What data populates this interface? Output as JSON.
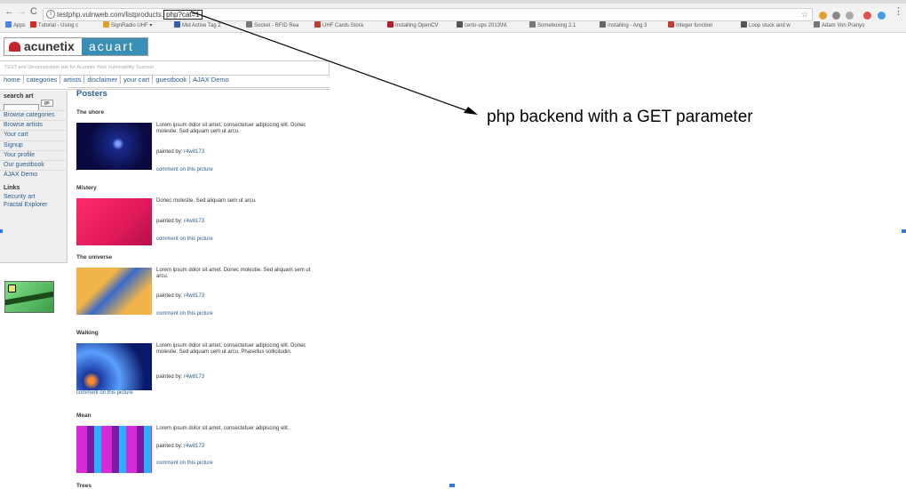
{
  "browser": {
    "back": "←",
    "forward": "→",
    "reload": "C",
    "url_base": "testphp.vulnweb.com/listproducts.",
    "url_query": "php?cat=1",
    "star": "☆",
    "menu": "⋮",
    "bookmarks": [
      {
        "label": "Apps",
        "color": "#4b84e8"
      },
      {
        "label": "Tutorial - Using c",
        "color": "#d62a2a"
      },
      {
        "label": "SignRadio UHF ▾",
        "color": "#e0a22a"
      },
      {
        "label": "Mid Active Tag 2",
        "color": "#3b5db0"
      },
      {
        "label": "Socket - RFID Rea",
        "color": "#777777"
      },
      {
        "label": "UHF Cards Stora",
        "color": "#c23b3b"
      },
      {
        "label": "Installing OpenCV",
        "color": "#b01f2a"
      },
      {
        "label": "certo-ups 2013\\N\\",
        "color": "#555555"
      },
      {
        "label": "Someboxing 2.1",
        "color": "#777777"
      },
      {
        "label": "Installing - Ang 3",
        "color": "#666666"
      },
      {
        "label": "Integer function",
        "color": "#c23b3b"
      },
      {
        "label": "Loop stuck and w",
        "color": "#555555"
      },
      {
        "label": "Adam Von Pranyo",
        "color": "#777777"
      }
    ],
    "extension_colors": [
      "#e0a22a",
      "#888888",
      "#aaaaaa",
      "#e25050",
      "#4b9be8",
      "#888888"
    ]
  },
  "site": {
    "logo_left": "acunetix",
    "logo_right": "acuart",
    "tagline": "TEST and Demonstration site for Acunetix Web Vulnerability Scanner",
    "nav": [
      "home",
      "categories",
      "artists",
      "disclaimer",
      "your cart",
      "guestbook",
      "AJAX Demo"
    ],
    "sidebar": {
      "search_label": "search art",
      "go_label": "go",
      "items": [
        "Browse categories",
        "Browse artists",
        "Your cart",
        "Signup",
        "Your profile",
        "Our guestbook",
        "AJAX Demo"
      ],
      "links_heading": "Links",
      "links": [
        "Security art",
        "Fractal Explorer"
      ]
    },
    "main_title": "Posters",
    "painted_by_label": "painted by:",
    "comment_label": "comment on this picture",
    "posters": [
      {
        "title": "The shore",
        "desc": "Lorem ipsum dolor sit amet, consectetuer adipiscing elit. Donec molestie. Sed aliquam sem ut arcu.",
        "artist": "r4w8173"
      },
      {
        "title": "Mistery",
        "desc": "Donec molestie. Sed aliquam sem ut arcu.",
        "artist": "r4w8173"
      },
      {
        "title": "The universe",
        "desc": "Lorem ipsum dolor sit amet. Donec molestie. Sed aliquam sem ut arcu.",
        "artist": "r4w8173"
      },
      {
        "title": "Walking",
        "desc": "Lorem ipsum dolor sit amet, consectetuer adipiscing elit. Donec molestie. Sed aliquam sem ut arcu. Phasellus sollicitudin.",
        "artist": "r4w8173"
      },
      {
        "title": "Mean",
        "desc": "Lorem ipsum dolor sit amet, consectetuer adipiscing elit.",
        "artist": "r4w8173"
      },
      {
        "title": "Trees",
        "desc": "",
        "artist": ""
      }
    ]
  },
  "annotation": "php backend with a GET parameter"
}
